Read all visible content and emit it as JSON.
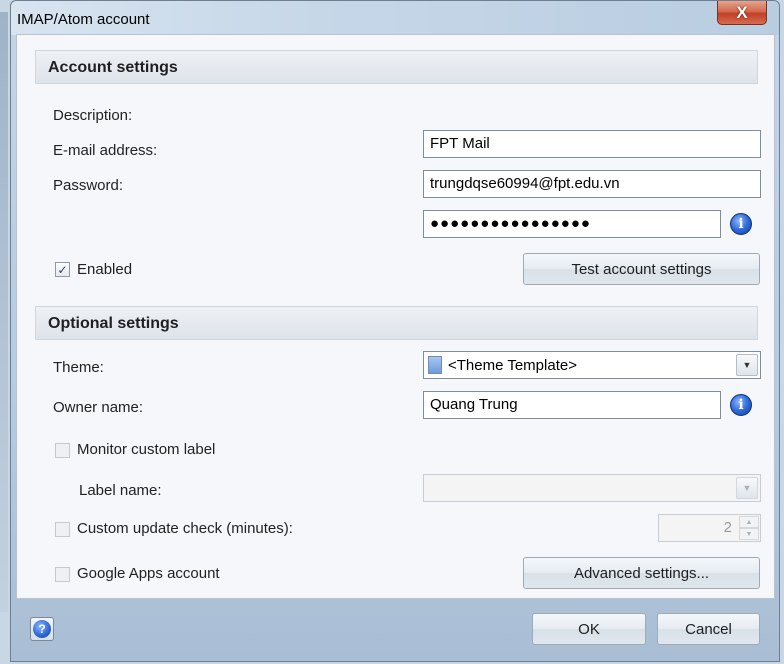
{
  "window": {
    "title": "IMAP/Atom account",
    "close_label": "X"
  },
  "account_settings": {
    "header": "Account settings",
    "description_label": "Description:",
    "description_value": "FPT Mail",
    "email_label": "E-mail address:",
    "email_value": "trungdqse60994@fpt.edu.vn",
    "password_label": "Password:",
    "password_value": "●●●●●●●●●●●●●●●●",
    "enabled_label": "Enabled",
    "enabled_checked": true,
    "test_button": "Test account settings"
  },
  "optional_settings": {
    "header": "Optional settings",
    "theme_label": "Theme:",
    "theme_value": "<Theme Template>",
    "owner_label": "Owner name:",
    "owner_value": "Quang Trung",
    "monitor_label": "Monitor custom label",
    "label_name_label": "Label name:",
    "label_name_value": "",
    "update_check_label": "Custom update check (minutes):",
    "update_check_value": "2",
    "google_apps_label": "Google Apps account",
    "advanced_button": "Advanced settings..."
  },
  "footer": {
    "help_glyph": "?",
    "ok_button": "OK",
    "cancel_button": "Cancel"
  },
  "icons": {
    "info": "i",
    "check": "✓",
    "down": "▼",
    "up": "▲"
  },
  "colors": {
    "accent": "#2f6cd8",
    "close": "#c0402a"
  }
}
